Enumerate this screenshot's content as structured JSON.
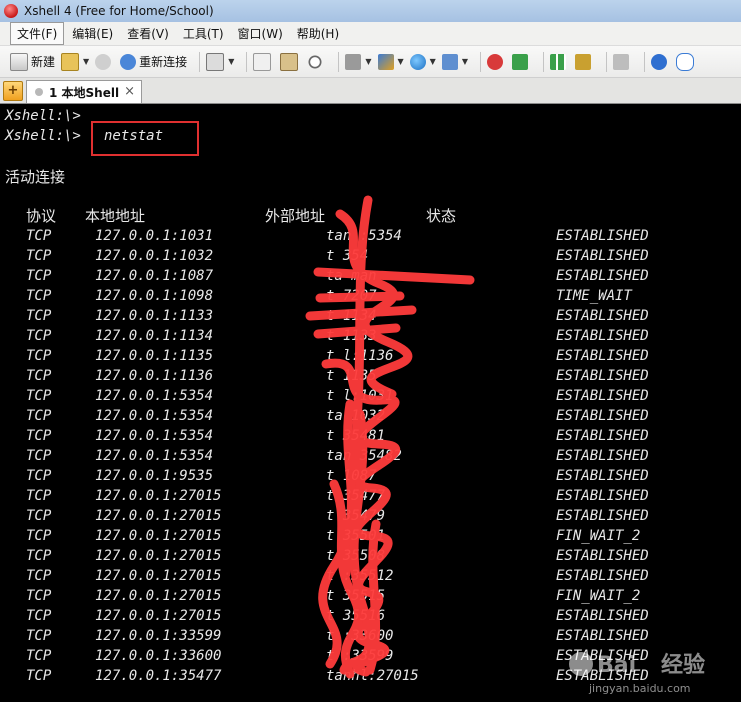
{
  "window": {
    "title": "Xshell 4 (Free for Home/School)"
  },
  "menu": [
    {
      "label": "文件(F)",
      "active": true
    },
    {
      "label": "编辑(E)"
    },
    {
      "label": "查看(V)"
    },
    {
      "label": "工具(T)"
    },
    {
      "label": "窗口(W)"
    },
    {
      "label": "帮助(H)"
    }
  ],
  "toolbar": {
    "new_label": "新建",
    "reconnect_label": "重新连接"
  },
  "tab": {
    "label": "1 本地Shell",
    "close": "×"
  },
  "terminal": {
    "prompt1": "Xshell:\\>",
    "prompt2": "Xshell:\\>",
    "command": "netstat",
    "heading": "活动连接",
    "headers": {
      "proto": "协议",
      "local": "本地地址",
      "foreign": "外部地址",
      "state": "状态"
    },
    "rows": [
      {
        "proto": "TCP",
        "local": "127.0.0.1:1031",
        "foreign": "tan :5354",
        "state": "ESTABLISHED"
      },
      {
        "proto": "TCP",
        "local": "127.0.0.1:1032",
        "foreign": "t    354",
        "state": "ESTABLISHED"
      },
      {
        "proto": "TCP",
        "local": "127.0.0.1:1087",
        "foreign": "ta    man",
        "state": "ESTABLISHED"
      },
      {
        "proto": "TCP",
        "local": "127.0.0.1:1098",
        "foreign": "t     7207",
        "state": "TIME_WAIT"
      },
      {
        "proto": "TCP",
        "local": "127.0.0.1:1133",
        "foreign": "t     1134",
        "state": "ESTABLISHED"
      },
      {
        "proto": "TCP",
        "local": "127.0.0.1:1134",
        "foreign": "t     1133",
        "state": "ESTABLISHED"
      },
      {
        "proto": "TCP",
        "local": "127.0.0.1:1135",
        "foreign": "t    l:1136",
        "state": "ESTABLISHED"
      },
      {
        "proto": "TCP",
        "local": "127.0.0.1:1136",
        "foreign": "t     1135",
        "state": "ESTABLISHED"
      },
      {
        "proto": "TCP",
        "local": "127.0.0.1:5354",
        "foreign": "t    l:1031",
        "state": "ESTABLISHED"
      },
      {
        "proto": "TCP",
        "local": "127.0.0.1:5354",
        "foreign": "ta    1032",
        "state": "ESTABLISHED"
      },
      {
        "proto": "TCP",
        "local": "127.0.0.1:5354",
        "foreign": "t     35481",
        "state": "ESTABLISHED"
      },
      {
        "proto": "TCP",
        "local": "127.0.0.1:5354",
        "foreign": "tan   35482",
        "state": "ESTABLISHED"
      },
      {
        "proto": "TCP",
        "local": "127.0.0.1:9535",
        "foreign": "t     1087",
        "state": "ESTABLISHED"
      },
      {
        "proto": "TCP",
        "local": "127.0.0.1:27015",
        "foreign": "t     35477",
        "state": "ESTABLISHED"
      },
      {
        "proto": "TCP",
        "local": "127.0.0.1:27015",
        "foreign": "t     35479",
        "state": "ESTABLISHED"
      },
      {
        "proto": "TCP",
        "local": "127.0.0.1:27015",
        "foreign": "t     35501",
        "state": "FIN_WAIT_2"
      },
      {
        "proto": "TCP",
        "local": "127.0.0.1:27015",
        "foreign": "t     35508",
        "state": "ESTABLISHED"
      },
      {
        "proto": "TCP",
        "local": "127.0.0.1:27015",
        "foreign": "t     :35512",
        "state": "ESTABLISHED"
      },
      {
        "proto": "TCP",
        "local": "127.0.0.1:27015",
        "foreign": "t     35515",
        "state": "FIN_WAIT_2"
      },
      {
        "proto": "TCP",
        "local": "127.0.0.1:27015",
        "foreign": "t     35516",
        "state": "ESTABLISHED"
      },
      {
        "proto": "TCP",
        "local": "127.0.0.1:33599",
        "foreign": "t     :33600",
        "state": "ESTABLISHED"
      },
      {
        "proto": "TCP",
        "local": "127.0.0.1:33600",
        "foreign": "t     :33599",
        "state": "ESTABLISHED"
      },
      {
        "proto": "TCP",
        "local": "127.0.0.1:35477",
        "foreign": "tanhl:27015",
        "state": "ESTABLISHED"
      }
    ]
  },
  "watermark": {
    "brand": "Bai",
    "brand2": "经验",
    "sub": "jingyan.baidu.com"
  },
  "colors": {
    "highlight_box": "#e03030",
    "scribble": "#ff3b3b"
  }
}
